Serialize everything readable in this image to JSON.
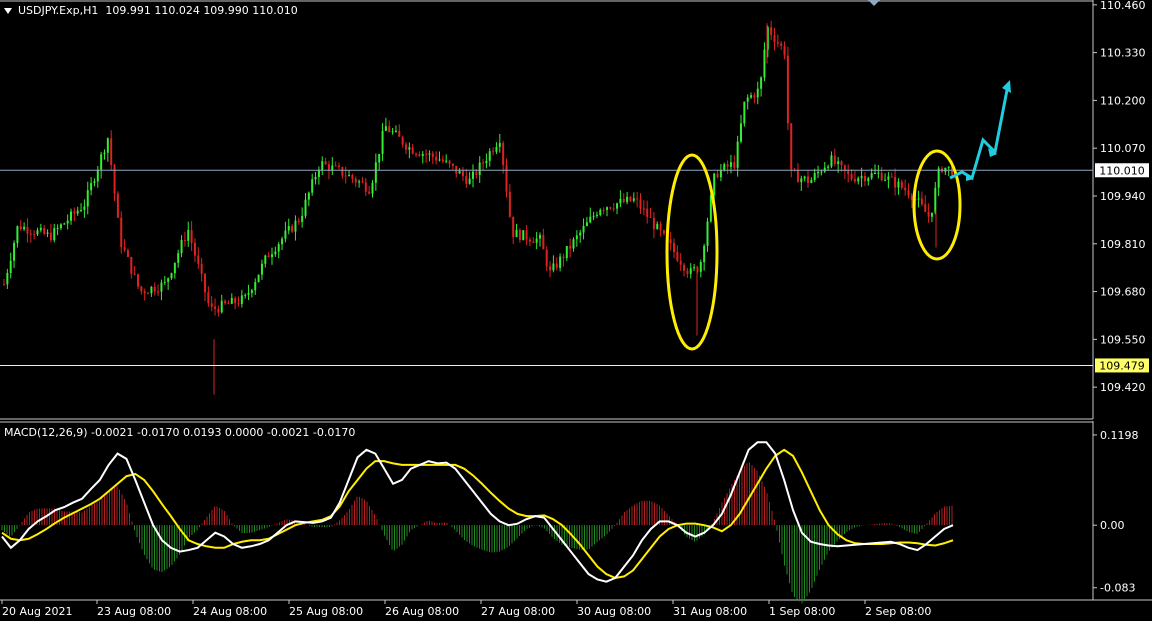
{
  "header": {
    "symbol": "USDJPY.Exp,H1",
    "ohlc": "109.991 110.024 109.990 110.010",
    "macd_label": "MACD(12,26,9) -0.0021 -0.0170 0.0193 0.0000 -0.0021 -0.0170"
  },
  "colors": {
    "background": "#000000",
    "bull": "#33ee33",
    "bear": "#dd2222",
    "grid": "#c8c8c8",
    "bid_line": "#8fa7bf",
    "level_line": "#ffff66",
    "macd_main": "#ffffff",
    "macd_signal": "#ffee00",
    "hist_pos": "#b02020",
    "hist_neg": "#1f8a1f",
    "annotation_ellipse": "#ffee00",
    "forecast_arrow": "#22ccdd"
  },
  "chart_data": [
    {
      "type": "candlestick",
      "title": "USDJPY.Exp,H1",
      "yaxis_ticks": [
        "110.460",
        "110.330",
        "110.200",
        "110.070",
        "109.940",
        "109.810",
        "109.680",
        "109.550",
        "109.420"
      ],
      "ylim": [
        109.385,
        110.465
      ],
      "current_price": "110.010",
      "level_price": "109.479",
      "grid": false,
      "annotations": [
        "ellipse around 31 Aug spike low",
        "ellipse around 2 Sep dip",
        "cyan forecast zigzag arrow upward"
      ]
    },
    {
      "type": "line",
      "title": "MACD(12,26,9)",
      "yaxis_ticks": [
        "0.1198",
        "0.00",
        "-0.083"
      ],
      "ylim": [
        -0.09,
        0.125
      ],
      "series": [
        {
          "name": "MACD",
          "values": [
            -0.015,
            -0.03,
            -0.02,
            -0.005,
            0.005,
            0.012,
            0.02,
            0.024,
            0.03,
            0.035,
            0.048,
            0.06,
            0.08,
            0.095,
            0.088,
            0.06,
            0.03,
            0.0,
            -0.02,
            -0.03,
            -0.035,
            -0.033,
            -0.03,
            -0.02,
            -0.01,
            -0.015,
            -0.025,
            -0.03,
            -0.028,
            -0.025,
            -0.02,
            -0.01,
            0.0,
            0.005,
            0.004,
            0.003,
            0.005,
            0.01,
            0.03,
            0.06,
            0.09,
            0.1,
            0.095,
            0.075,
            0.055,
            0.06,
            0.075,
            0.08,
            0.085,
            0.082,
            0.083,
            0.075,
            0.06,
            0.045,
            0.03,
            0.015,
            0.005,
            0.0,
            0.002,
            0.008,
            0.012,
            0.01,
            -0.005,
            -0.02,
            -0.035,
            -0.05,
            -0.065,
            -0.072,
            -0.075,
            -0.07,
            -0.055,
            -0.04,
            -0.02,
            -0.005,
            0.005,
            0.005,
            0.0,
            -0.01,
            -0.015,
            -0.01,
            0.0,
            0.015,
            0.04,
            0.07,
            0.1,
            0.11,
            0.11,
            0.095,
            0.06,
            0.02,
            -0.01,
            -0.022,
            -0.025,
            -0.027,
            -0.028,
            -0.027,
            -0.026,
            -0.025,
            -0.024,
            -0.023,
            -0.022,
            -0.025,
            -0.03,
            -0.033,
            -0.025,
            -0.015,
            -0.005,
            0.0
          ]
        },
        {
          "name": "Signal",
          "values": [
            -0.01,
            -0.018,
            -0.02,
            -0.018,
            -0.012,
            -0.005,
            0.003,
            0.01,
            0.016,
            0.022,
            0.028,
            0.035,
            0.045,
            0.055,
            0.065,
            0.068,
            0.06,
            0.045,
            0.028,
            0.012,
            -0.005,
            -0.02,
            -0.025,
            -0.028,
            -0.03,
            -0.03,
            -0.025,
            -0.022,
            -0.02,
            -0.02,
            -0.018,
            -0.012,
            -0.006,
            0.0,
            0.003,
            0.005,
            0.007,
            0.012,
            0.025,
            0.045,
            0.06,
            0.075,
            0.085,
            0.085,
            0.082,
            0.08,
            0.08,
            0.08,
            0.08,
            0.08,
            0.08,
            0.08,
            0.075,
            0.066,
            0.055,
            0.043,
            0.032,
            0.022,
            0.015,
            0.012,
            0.012,
            0.013,
            0.008,
            0.0,
            -0.012,
            -0.025,
            -0.04,
            -0.055,
            -0.065,
            -0.07,
            -0.068,
            -0.06,
            -0.045,
            -0.03,
            -0.015,
            -0.005,
            0.0,
            0.002,
            0.002,
            0.0,
            -0.003,
            -0.008,
            0.0,
            0.015,
            0.035,
            0.055,
            0.075,
            0.092,
            0.1,
            0.092,
            0.07,
            0.045,
            0.02,
            0.0,
            -0.012,
            -0.02,
            -0.024,
            -0.025,
            -0.025,
            -0.025,
            -0.024,
            -0.023,
            -0.023,
            -0.024,
            -0.026,
            -0.027,
            -0.024,
            -0.02
          ]
        }
      ]
    }
  ],
  "xaxis_labels": [
    "20 Aug 2021",
    "23 Aug 08:00",
    "24 Aug 08:00",
    "25 Aug 08:00",
    "26 Aug 08:00",
    "27 Aug 08:00",
    "30 Aug 08:00",
    "31 Aug 08:00",
    "1 Sep 08:00",
    "2 Sep 08:00"
  ]
}
